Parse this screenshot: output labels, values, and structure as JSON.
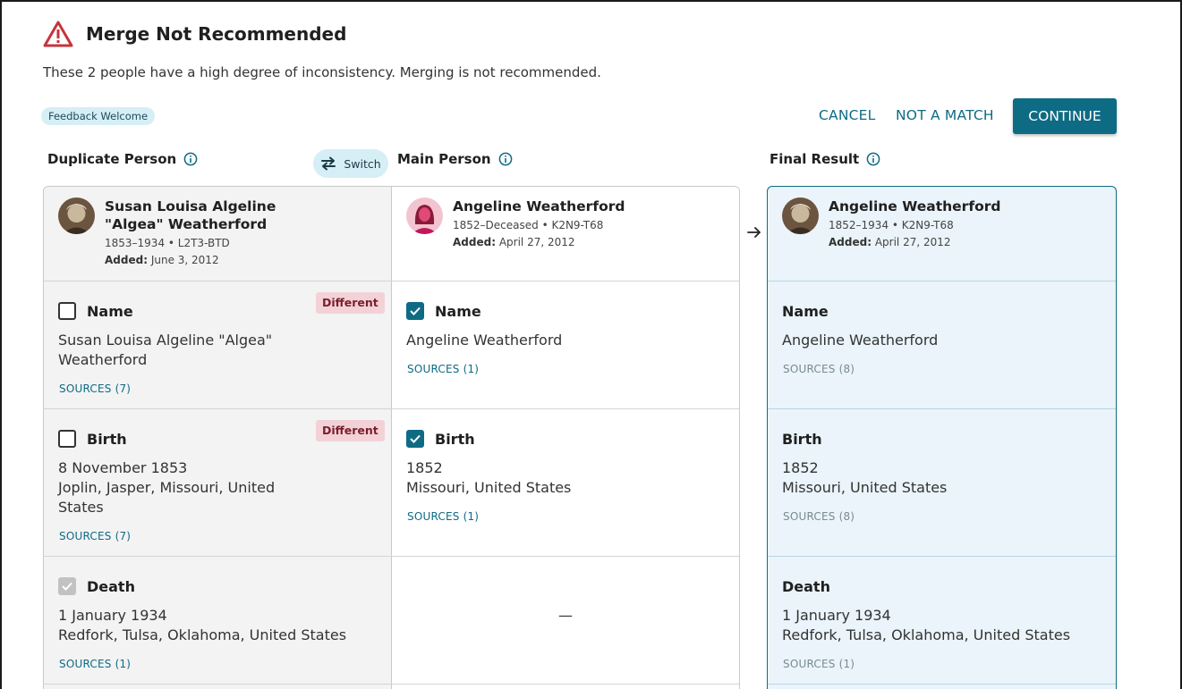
{
  "header": {
    "title": "Merge Not Recommended",
    "subtitle": "These 2 people have a high degree of inconsistency. Merging is not recommended.",
    "feedback_badge": "Feedback Welcome",
    "warning_icon": "warning-triangle-icon",
    "warning_color": "#c6343c"
  },
  "actions": {
    "cancel": "CANCEL",
    "not_a_match": "NOT A MATCH",
    "continue": "CONTINUE",
    "accent": "#0e6b84"
  },
  "columns": {
    "duplicate": "Duplicate Person",
    "main": "Main Person",
    "final": "Final Result",
    "switch": "Switch"
  },
  "duplicate_person": {
    "name": "Susan Louisa Algeline \"Algea\" Weatherford",
    "lifespan_id": "1853–1934 • L2T3-BTD",
    "added_label": "Added:",
    "added_date": "June 3, 2012"
  },
  "main_person": {
    "name": "Angeline Weatherford",
    "lifespan_id": "1852–Deceased • K2N9-T68",
    "added_label": "Added:",
    "added_date": "April 27, 2012"
  },
  "final_person": {
    "name": "Angeline Weatherford",
    "lifespan_id": "1852–1934 • K2N9-T68",
    "added_label": "Added:",
    "added_date": "April 27, 2012"
  },
  "rows": {
    "name": {
      "label": "Name",
      "different": "Different",
      "dup_value": "Susan Louisa Algeline \"Algea\" Weatherford",
      "dup_sources": "SOURCES (7)",
      "main_value": "Angeline Weatherford",
      "main_sources": "SOURCES (1)",
      "final_value": "Angeline Weatherford",
      "final_sources": "SOURCES (8)"
    },
    "birth": {
      "label": "Birth",
      "different": "Different",
      "dup_date": "8 November 1853",
      "dup_place": "Joplin, Jasper, Missouri, United States",
      "dup_sources": "SOURCES (7)",
      "main_date": "1852",
      "main_place": "Missouri, United States",
      "main_sources": "SOURCES (1)",
      "final_date": "1852",
      "final_place": "Missouri, United States",
      "final_sources": "SOURCES (8)"
    },
    "death": {
      "label": "Death",
      "dup_date": "1 January 1934",
      "dup_place": "Redfork, Tulsa, Oklahoma, United States",
      "dup_sources": "SOURCES (1)",
      "main_empty": "—",
      "final_date": "1 January 1934",
      "final_place": "Redfork, Tulsa, Oklahoma, United States",
      "final_sources": "SOURCES (1)"
    }
  }
}
